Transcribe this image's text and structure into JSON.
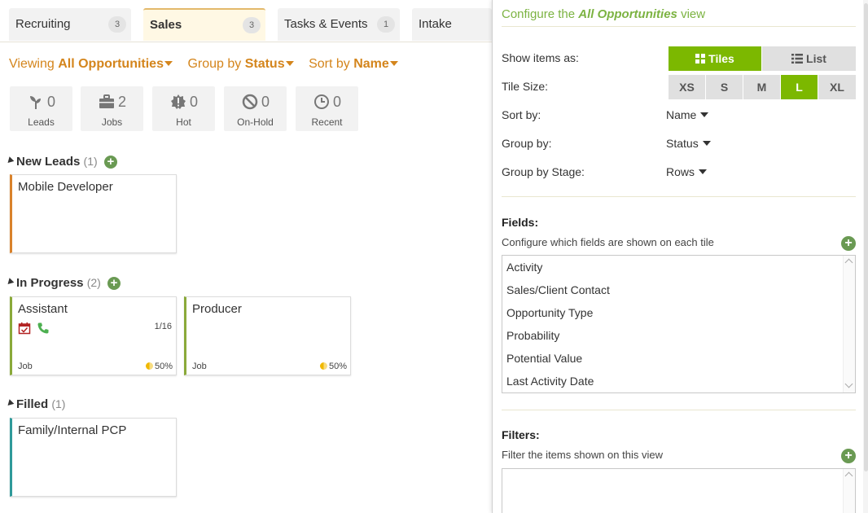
{
  "tabs": [
    {
      "label": "Recruiting",
      "count": "3"
    },
    {
      "label": "Sales",
      "count": "3",
      "active": true
    },
    {
      "label": "Tasks & Events",
      "count": "1"
    },
    {
      "label": "Intake"
    }
  ],
  "viewbar": {
    "viewing_label": "Viewing",
    "viewing_value": "All Opportunities",
    "group_label": "Group by",
    "group_value": "Status",
    "sort_label": "Sort by",
    "sort_value": "Name"
  },
  "counters": [
    {
      "icon": "sprout-icon",
      "value": "0",
      "label": "Leads"
    },
    {
      "icon": "briefcase-icon",
      "value": "2",
      "label": "Jobs"
    },
    {
      "icon": "hot-badge-icon",
      "value": "0",
      "label": "Hot"
    },
    {
      "icon": "no-entry-icon",
      "value": "0",
      "label": "On-Hold"
    },
    {
      "icon": "clock-icon",
      "value": "0",
      "label": "Recent"
    }
  ],
  "groups": [
    {
      "title": "New Leads",
      "count": "(1)",
      "tiles": [
        {
          "title": "Mobile Developer",
          "accent": "#d9822b"
        }
      ]
    },
    {
      "title": "In Progress",
      "count": "(2)",
      "tiles": [
        {
          "title": "Assistant",
          "accent": "#8aa93a",
          "ratio": "1/16",
          "type": "Job",
          "probability": "50%",
          "icons": [
            "calendar-check-icon",
            "phone-icon"
          ]
        },
        {
          "title": "Producer",
          "accent": "#8aa93a",
          "type": "Job",
          "probability": "50%"
        }
      ]
    },
    {
      "title": "Filled",
      "count": "(1)",
      "tiles": [
        {
          "title": "Family/Internal PCP",
          "accent": "#2f9a9a"
        }
      ]
    }
  ],
  "config": {
    "title_prefix": "Configure the",
    "title_em": "All Opportunities",
    "title_suffix": "view",
    "show_items_label": "Show items as:",
    "view_tiles": "Tiles",
    "view_list": "List",
    "tile_size_label": "Tile Size:",
    "tile_sizes": [
      "XS",
      "S",
      "M",
      "L",
      "XL"
    ],
    "tile_size_selected": "L",
    "sort_label": "Sort by:",
    "sort_value": "Name",
    "group_label": "Group by:",
    "group_value": "Status",
    "stage_label": "Group by Stage:",
    "stage_value": "Rows",
    "fields_title": "Fields:",
    "fields_sub": "Configure which fields are shown on each tile",
    "fields": [
      "Activity",
      "Sales/Client Contact",
      "Opportunity Type",
      "Probability",
      "Potential Value",
      "Last Activity Date"
    ],
    "filters_title": "Filters:",
    "filters_sub": "Filter the items shown on this view"
  },
  "colors": {
    "accent_orange": "#d4851c",
    "accent_green": "#7cb800",
    "plus_green": "#6a9a53"
  }
}
